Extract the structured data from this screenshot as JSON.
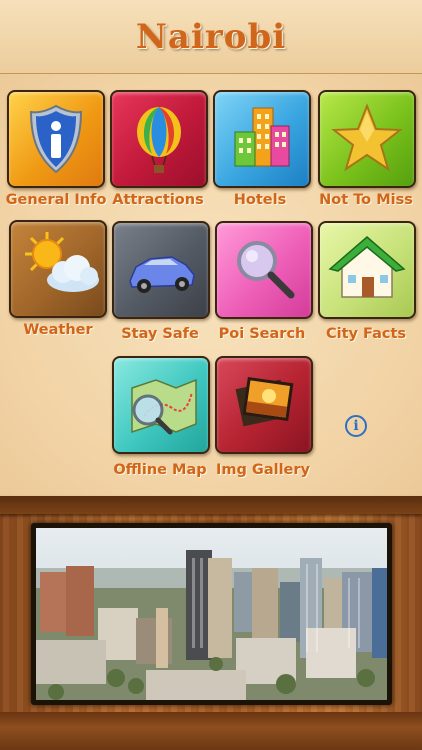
{
  "app": {
    "title": "Nairobi"
  },
  "tiles": [
    {
      "label": "General Info",
      "icon": "info-shield-icon",
      "color": "#f0a020"
    },
    {
      "label": "Attractions",
      "icon": "hot-air-balloon-icon",
      "color": "#c0193a"
    },
    {
      "label": "Hotels",
      "icon": "buildings-icon",
      "color": "#3aa6e0"
    },
    {
      "label": "Not To Miss",
      "icon": "star-icon",
      "color": "#7bc21c"
    },
    {
      "label": "Weather",
      "icon": "sun-cloud-icon",
      "color": "#a0662a"
    },
    {
      "label": "Stay Safe",
      "icon": "car-icon",
      "color": "#545a64"
    },
    {
      "label": "Poi Search",
      "icon": "magnifier-icon",
      "color": "#ee5fb8"
    },
    {
      "label": "City Facts",
      "icon": "house-icon",
      "color": "#c8e27a"
    },
    {
      "label": "Offline Map",
      "icon": "map-magnifier-icon",
      "color": "#3fc8c0"
    },
    {
      "label": "Img Gallery",
      "icon": "photo-stack-icon",
      "color": "#b52330"
    }
  ],
  "info_button": {
    "glyph": "i",
    "icon": "info-circle-icon"
  },
  "footer_image": {
    "subject": "city-skyline-photo"
  }
}
